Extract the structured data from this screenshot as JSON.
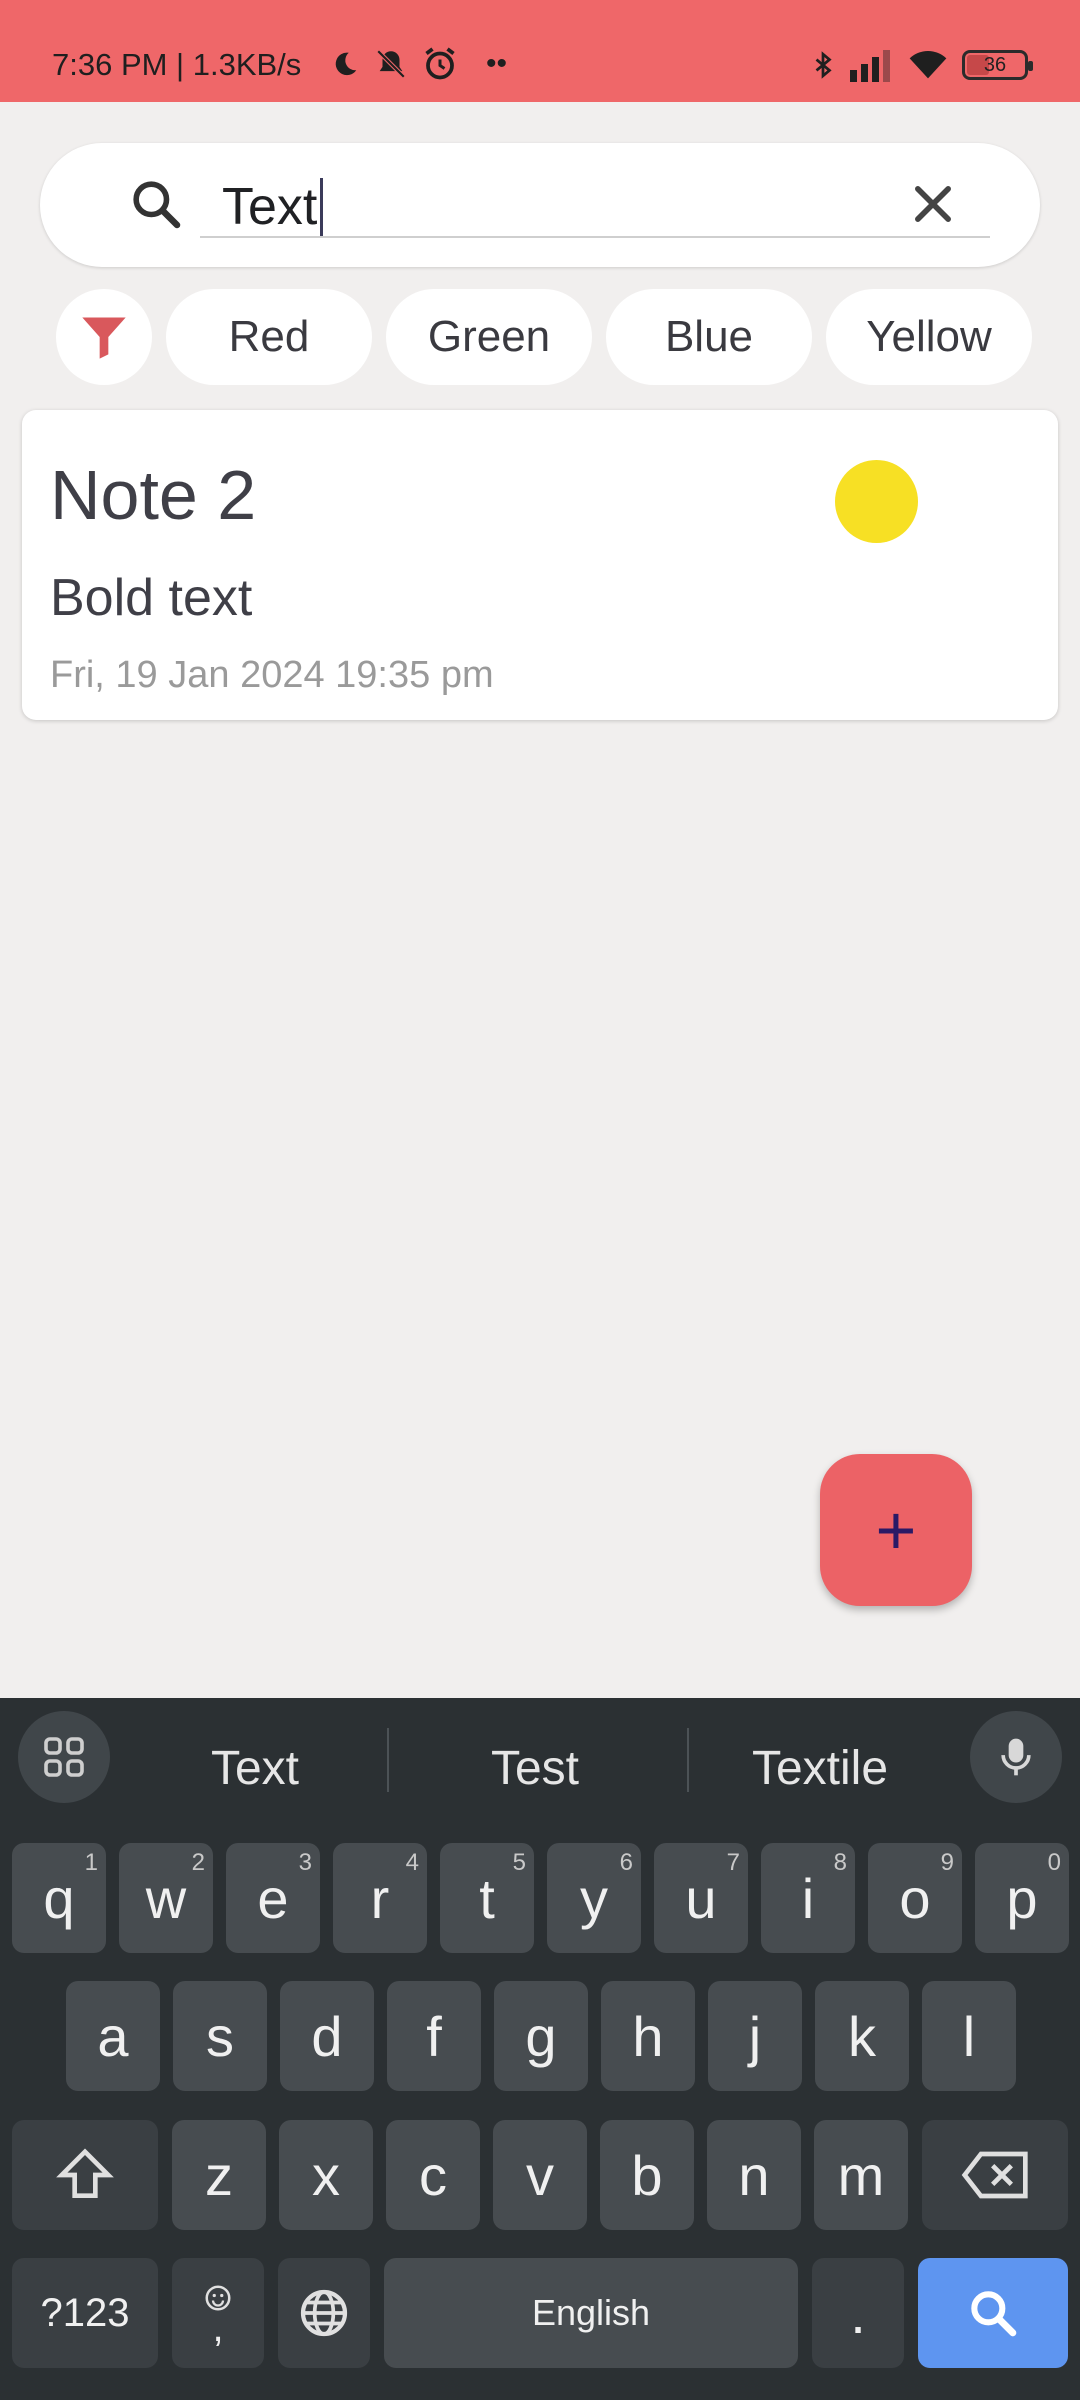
{
  "status_bar": {
    "left_text": "7:36 PM | 1.3KB/s",
    "battery": "36"
  },
  "search": {
    "value": "Text",
    "placeholder": ""
  },
  "filter_chips": [
    "Red",
    "Green",
    "Blue",
    "Yellow"
  ],
  "notes": [
    {
      "title": "Note 2",
      "body": "Bold text",
      "date": "Fri, 19 Jan 2024 19:35 pm",
      "color": "#f7e024"
    }
  ],
  "fab": {
    "label": "+"
  },
  "keyboard": {
    "suggestions": [
      "Text",
      "Test",
      "Textile"
    ],
    "row1": [
      {
        "key": "q",
        "hint": "1"
      },
      {
        "key": "w",
        "hint": "2"
      },
      {
        "key": "e",
        "hint": "3"
      },
      {
        "key": "r",
        "hint": "4"
      },
      {
        "key": "t",
        "hint": "5"
      },
      {
        "key": "y",
        "hint": "6"
      },
      {
        "key": "u",
        "hint": "7"
      },
      {
        "key": "i",
        "hint": "8"
      },
      {
        "key": "o",
        "hint": "9"
      },
      {
        "key": "p",
        "hint": "0"
      }
    ],
    "row2": [
      "a",
      "s",
      "d",
      "f",
      "g",
      "h",
      "j",
      "k",
      "l"
    ],
    "row3": [
      "z",
      "x",
      "c",
      "v",
      "b",
      "n",
      "m"
    ],
    "symbols_label": "?123",
    "comma_label": ",",
    "space_label": "English",
    "period_label": "."
  },
  "colors": {
    "accent": "#ef6769",
    "fab": "#ec6266",
    "keyboard_bg": "#2b3033",
    "enter_key": "#5e95f0"
  }
}
